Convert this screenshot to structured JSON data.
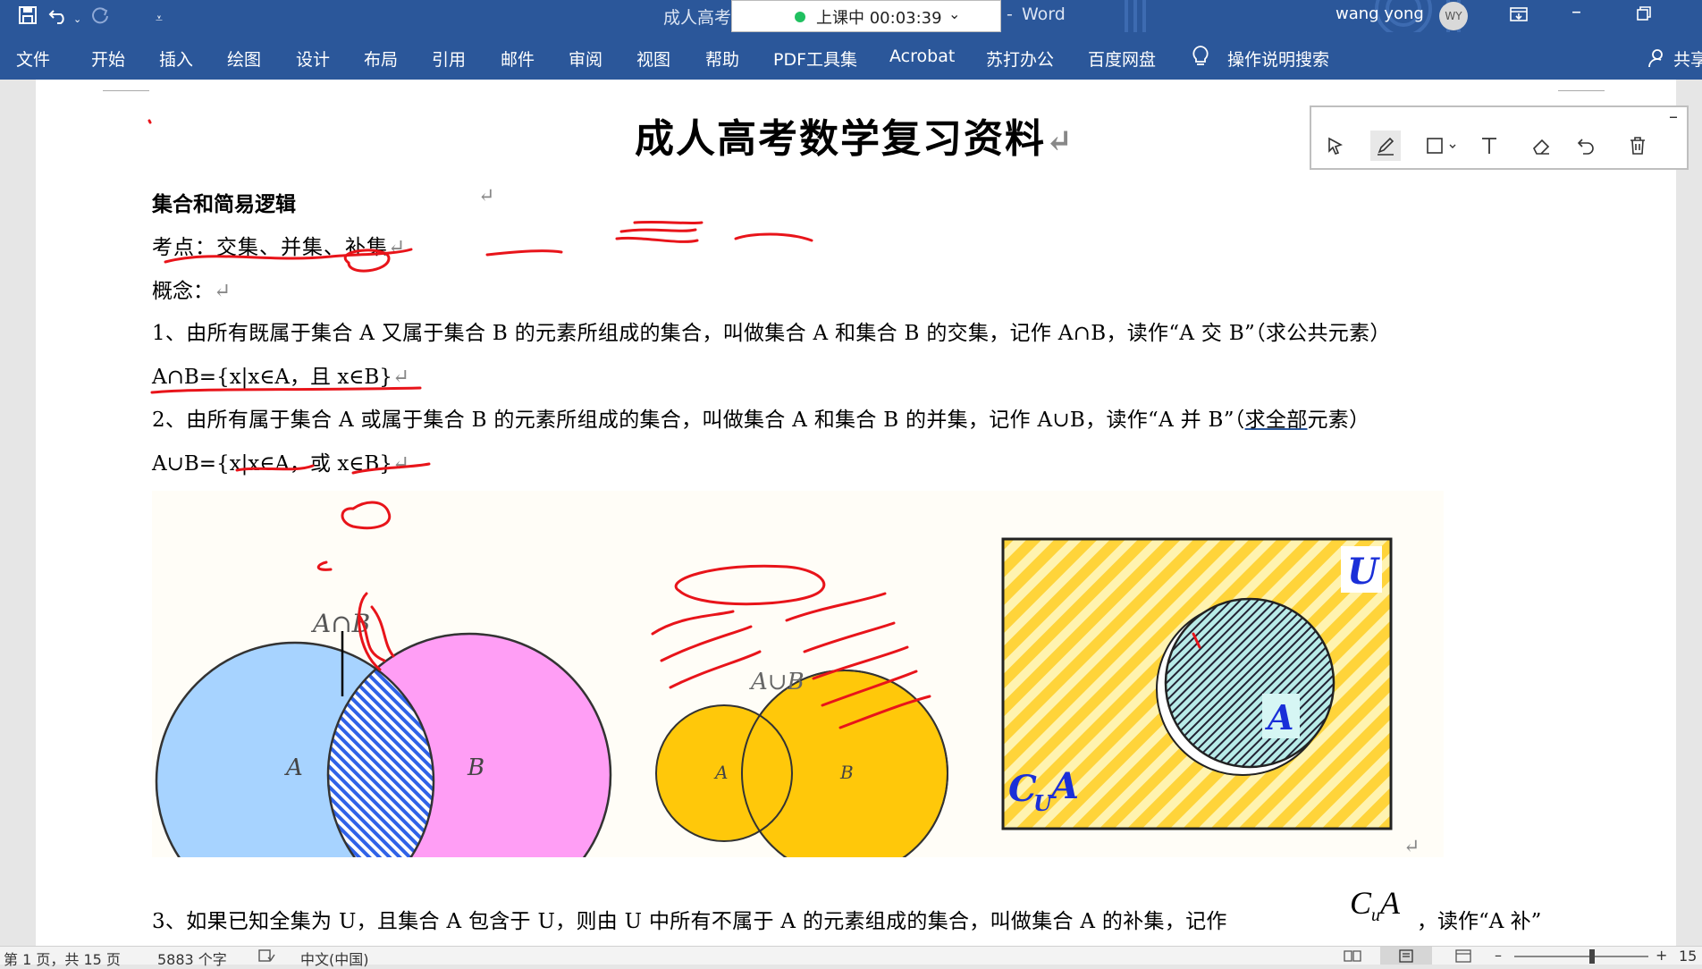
{
  "titlebar": {
    "doc_title_partial": "成人高考",
    "app_name": "Word",
    "separator": "-",
    "user_name": "wang yong",
    "avatar_initials": "WY",
    "timer_label": "上课中 00:03:39"
  },
  "ribbon": {
    "tabs": [
      "文件",
      "开始",
      "插入",
      "绘图",
      "设计",
      "布局",
      "引用",
      "邮件",
      "审阅",
      "视图",
      "帮助",
      "PDF工具集",
      "Acrobat",
      "苏打办公",
      "百度网盘"
    ],
    "search_label": "操作说明搜索",
    "share_label": "共享"
  },
  "document": {
    "title": "成人高考数学复习资料",
    "section_heading": "集合和简易逻辑",
    "exam_points": "考点：交集、并集、补集",
    "concept_label": "概念：",
    "para1": "1、由所有既属于集合 A 又属于集合 B 的元素所组成的集合，叫做集合 A 和集合 B 的交集，记作 A∩B，读作“A 交 B”（求公共元素）",
    "formula1": "A∩B={x|x∈A，且 x∈B}",
    "para2_start": "2、由所有属于集合 A 或属于集合 B 的元素所组成的集合，叫做集合 A 和集合 B 的并集，记作 A∪B，读作“A 并 B”（",
    "para2_underlined": "求全部",
    "para2_end": "元素）",
    "formula2": "A∪B={x|x∈A，或 x∈B}",
    "para3": "3、如果已知全集为 U，且集合 A 包含于 U，则由 U 中所有不属于 A 的元素组成的集合，叫做集合 A 的补集，记作",
    "para3_symbol_c": "C",
    "para3_symbol_u": "u",
    "para3_symbol_a": "A",
    "para3_end": "，读作“A 补”",
    "paragraph_mark": "↵"
  },
  "diagrams": {
    "intersection": {
      "label_top": "A∩B",
      "label_a": "A",
      "label_b": "B",
      "color_a": "#a7d3ff",
      "color_b": "#ff9ef5"
    },
    "union": {
      "label_top": "A∪B",
      "label_a": "A",
      "label_b": "B",
      "color": "#ffc80a"
    },
    "complement": {
      "label_u": "U",
      "label_a": "A",
      "label_c": "C",
      "label_cu": "U",
      "label_ca": "A",
      "stripe_color": "#ffd43a",
      "fill_color": "#b8ebe8"
    }
  },
  "ink_toolbar": {
    "tools": [
      "select-icon",
      "pen-icon",
      "shape-icon",
      "text-icon",
      "eraser-icon",
      "undo-icon",
      "delete-icon"
    ],
    "minimize": "–"
  },
  "statusbar": {
    "page_info": "第 1 页，共 15 页",
    "word_count": "5883 个字",
    "language": "中文(中国)",
    "zoom_minus": "–",
    "zoom_plus": "+",
    "zoom_value": "15"
  },
  "colors": {
    "ribbon": "#2b579a",
    "ink": "#e8141a"
  }
}
